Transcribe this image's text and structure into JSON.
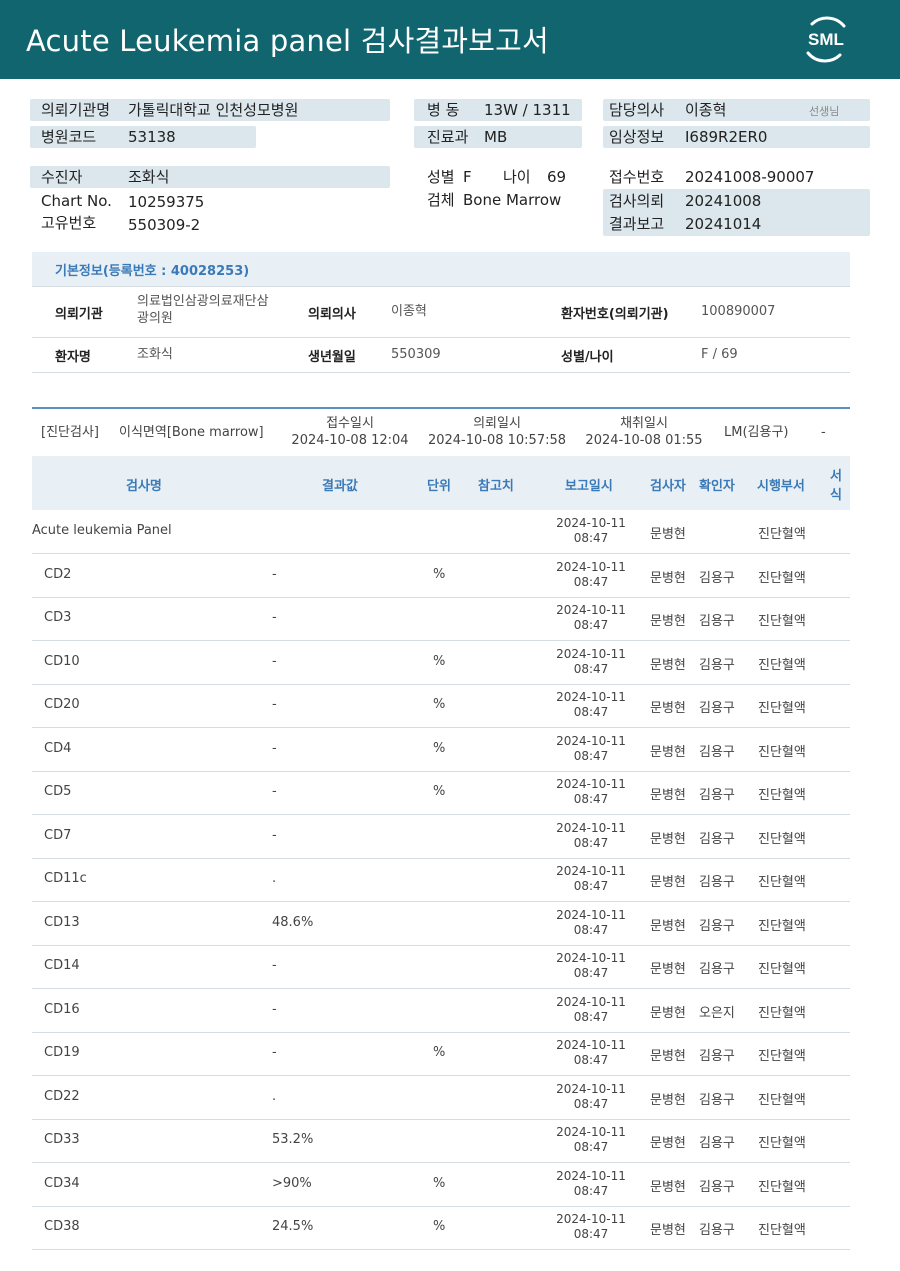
{
  "report": {
    "title": "Acute  Leukemia  panel 검사결과보고서",
    "logo_text": "SML",
    "brand_color": "#10656e",
    "accent_color": "#3a7ab8"
  },
  "info": {
    "inst_label": "의뢰기관명",
    "inst_value": "가톨릭대학교 인천성모병원",
    "code_label": "병원코드",
    "code_value": "53138",
    "patient_label": "수진자",
    "patient_value": "조화식",
    "chart_label": "Chart No.",
    "chart_value": "10259375",
    "uid_label": "고유번호",
    "uid_value": "550309-2",
    "ward_label": "병  동",
    "ward_value": "13W / 1311",
    "dept_label": "진료과",
    "dept_value": "MB",
    "sex_label": "성별",
    "sex_value": "F",
    "age_label": "나이",
    "age_value": "69",
    "specimen_label": "검체",
    "specimen_value": "Bone Marrow",
    "doctor_label": "담당의사",
    "doctor_value": "이종혁",
    "doctor_suffix": "선생님",
    "clinical_label": "임상정보",
    "clinical_value": "I689R2ER0",
    "receipt_label": "접수번호",
    "receipt_value": "20241008-90007",
    "request_label": "검사의뢰",
    "request_value": "20241008",
    "result_label": "결과보고",
    "result_value": "20241014"
  },
  "basic": {
    "title": "기본정보(등록번호 : 40028253)",
    "inst_label": "의뢰기관",
    "inst_value_1": "의료법인삼광의료재단삼",
    "inst_value_2": "광의원",
    "doctor_label": "의뢰의사",
    "doctor_value": "이종혁",
    "patno_label": "환자번호(의뢰기관)",
    "patno_value": "100890007",
    "name_label": "환자명",
    "name_value": "조화식",
    "dob_label": "생년월일",
    "dob_value": "550309",
    "sexage_label": "성별/나이",
    "sexage_value": "F / 69"
  },
  "diagnosis": {
    "category": "[진단검사]",
    "test": "이식면역[Bone marrow]",
    "receipt_label": "접수일시",
    "receipt_value": "2024-10-08 12:04",
    "request_label": "의뢰일시",
    "request_value": "2024-10-08 10:57:58",
    "collect_label": "채취일시",
    "collect_value": "2024-10-08 01:55",
    "lm": "LM(김용구)",
    "dash": "-"
  },
  "table": {
    "headers": {
      "name": "검사명",
      "result": "결과값",
      "unit": "단위",
      "ref": "참고치",
      "report": "보고일시",
      "tester": "검사자",
      "confirmer": "확인자",
      "dept": "시행부서",
      "form_1": "서",
      "form_2": "식"
    },
    "rows": [
      {
        "name": "Acute leukemia Panel",
        "result": "",
        "unit": "",
        "date": "2024-10-11",
        "time": "08:47",
        "tester": "문병현",
        "confirmer": "",
        "dept": "진단혈액"
      },
      {
        "name": "CD2",
        "result": "-",
        "unit": "%",
        "date": "2024-10-11",
        "time": "08:47",
        "tester": "문병현",
        "confirmer": "김용구",
        "dept": "진단혈액"
      },
      {
        "name": "CD3",
        "result": "-",
        "unit": "",
        "date": "2024-10-11",
        "time": "08:47",
        "tester": "문병현",
        "confirmer": "김용구",
        "dept": "진단혈액"
      },
      {
        "name": "CD10",
        "result": "-",
        "unit": "%",
        "date": "2024-10-11",
        "time": "08:47",
        "tester": "문병현",
        "confirmer": "김용구",
        "dept": "진단혈액"
      },
      {
        "name": "CD20",
        "result": "-",
        "unit": "%",
        "date": "2024-10-11",
        "time": "08:47",
        "tester": "문병현",
        "confirmer": "김용구",
        "dept": "진단혈액"
      },
      {
        "name": "CD4",
        "result": "-",
        "unit": "%",
        "date": "2024-10-11",
        "time": "08:47",
        "tester": "문병현",
        "confirmer": "김용구",
        "dept": "진단혈액"
      },
      {
        "name": "CD5",
        "result": "-",
        "unit": "%",
        "date": "2024-10-11",
        "time": "08:47",
        "tester": "문병현",
        "confirmer": "김용구",
        "dept": "진단혈액"
      },
      {
        "name": "CD7",
        "result": "-",
        "unit": "",
        "date": "2024-10-11",
        "time": "08:47",
        "tester": "문병현",
        "confirmer": "김용구",
        "dept": "진단혈액"
      },
      {
        "name": "CD11c",
        "result": ".",
        "unit": "",
        "date": "2024-10-11",
        "time": "08:47",
        "tester": "문병현",
        "confirmer": "김용구",
        "dept": "진단혈액"
      },
      {
        "name": "CD13",
        "result": "48.6%",
        "unit": "",
        "date": "2024-10-11",
        "time": "08:47",
        "tester": "문병현",
        "confirmer": "김용구",
        "dept": "진단혈액"
      },
      {
        "name": "CD14",
        "result": "-",
        "unit": "",
        "date": "2024-10-11",
        "time": "08:47",
        "tester": "문병현",
        "confirmer": "김용구",
        "dept": "진단혈액"
      },
      {
        "name": "CD16",
        "result": "-",
        "unit": "",
        "date": "2024-10-11",
        "time": "08:47",
        "tester": "문병현",
        "confirmer": "오은지",
        "dept": "진단혈액"
      },
      {
        "name": "CD19",
        "result": "-",
        "unit": "%",
        "date": "2024-10-11",
        "time": "08:47",
        "tester": "문병현",
        "confirmer": "김용구",
        "dept": "진단혈액"
      },
      {
        "name": "CD22",
        "result": ".",
        "unit": "",
        "date": "2024-10-11",
        "time": "08:47",
        "tester": "문병현",
        "confirmer": "김용구",
        "dept": "진단혈액"
      },
      {
        "name": "CD33",
        "result": "53.2%",
        "unit": "",
        "date": "2024-10-11",
        "time": "08:47",
        "tester": "문병현",
        "confirmer": "김용구",
        "dept": "진단혈액"
      },
      {
        "name": "CD34",
        "result": ">90%",
        "unit": "%",
        "date": "2024-10-11",
        "time": "08:47",
        "tester": "문병현",
        "confirmer": "김용구",
        "dept": "진단혈액"
      },
      {
        "name": "CD38",
        "result": "24.5%",
        "unit": "%",
        "date": "2024-10-11",
        "time": "08:47",
        "tester": "문병현",
        "confirmer": "김용구",
        "dept": "진단혈액"
      }
    ]
  }
}
